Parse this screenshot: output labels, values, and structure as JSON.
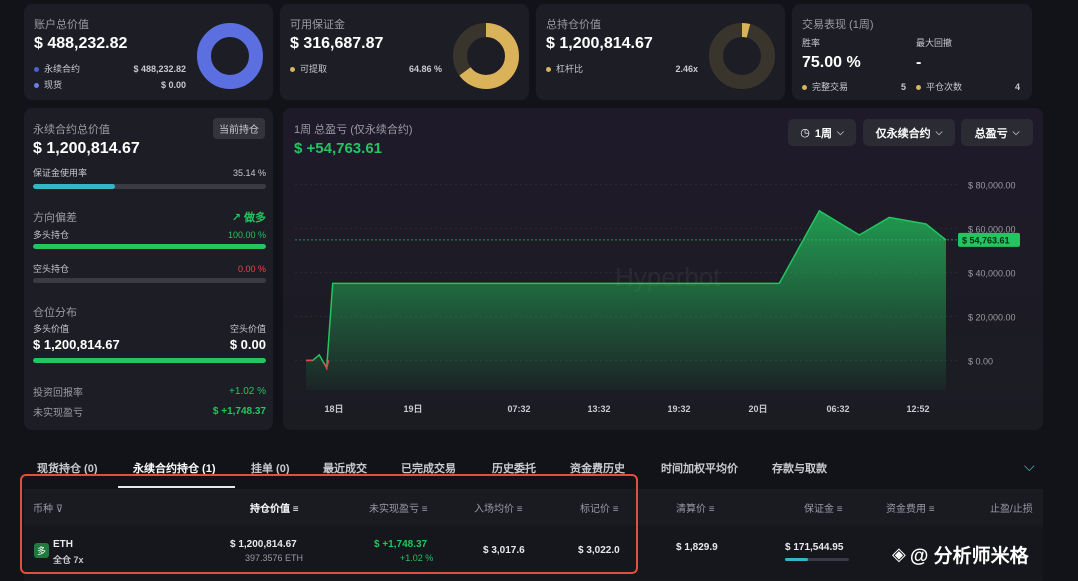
{
  "summary": {
    "account": {
      "title": "账户总价值",
      "value": "$ 488,232.82",
      "items": [
        {
          "label": "永续合约",
          "value": "$ 488,232.82",
          "color": "#4c5fd5"
        },
        {
          "label": "现货",
          "value": "$ 0.00",
          "color": "#6b7de8"
        }
      ],
      "donut_fraction": 1.0,
      "donut_color": "#5b6fe0"
    },
    "margin": {
      "title": "可用保证金",
      "value": "$ 316,687.87",
      "item_label": "可提取",
      "item_value": "64.86 %",
      "color": "#d9b25a",
      "donut_fraction": 0.6486
    },
    "position": {
      "title": "总持仓价值",
      "value": "$ 1,200,814.67",
      "item_label": "杠杆比",
      "item_value": "2.46x",
      "color": "#d9b25a",
      "donut_fraction": 0.04
    },
    "performance": {
      "title": "交易表现 (1周)",
      "win_label": "胜率",
      "win_value": "75.00 %",
      "dd_label": "最大回撤",
      "dd_value": "-",
      "completed_label": "完整交易",
      "completed_value": "5",
      "close_label": "平仓次数",
      "close_value": "4"
    }
  },
  "perp": {
    "title": "永续合约总价值",
    "badge": "当前持仓",
    "value": "$ 1,200,814.67",
    "margin_usage_label": "保证金使用率",
    "margin_usage_value": "35.14 %",
    "margin_usage": 0.3514,
    "bias_label": "方向偏差",
    "bias_value": "做多",
    "long_label": "多头持仓",
    "long_value": "100.00 %",
    "long": 1.0,
    "short_label": "空头持仓",
    "short_value": "0.00 %",
    "short": 0.0,
    "dist_label": "仓位分布",
    "long_val_label": "多头价值",
    "long_val": "$ 1,200,814.67",
    "short_val_label": "空头价值",
    "short_val": "$ 0.00",
    "roi_label": "投资回报率",
    "roi_value": "+1.02 %",
    "upnl_label": "未实现盈亏",
    "upnl_value": "$ +1,748.37"
  },
  "chart": {
    "title": "1周 总盈亏 (仅永续合约)",
    "value": "$ +54,763.61",
    "controls": {
      "period": "1周",
      "scope": "仅永续合约",
      "metric": "总盈亏"
    },
    "watermark": "Hyperbot",
    "current_label": "$ 54,763.61"
  },
  "chart_data": {
    "type": "area",
    "title": "1周 总盈亏 (仅永续合约)",
    "x_ticks": [
      "18日",
      "19日",
      "07:32",
      "13:32",
      "19:32",
      "20日",
      "06:32",
      "12:52"
    ],
    "y_ticks": [
      "$ 0.00",
      "$ 20,000.00",
      "$ 40,000.00",
      "$ 60,000.00",
      "$ 80,000.00"
    ],
    "ylim": [
      -3000,
      82000
    ],
    "x": [
      0,
      0.1,
      0.2,
      0.31,
      0.4,
      0.65,
      1.0,
      3.8,
      5.2,
      6.8,
      7.1,
      7.7,
      8.3,
      8.75,
      9.3,
      9.6
    ],
    "y": [
      0,
      0,
      2500,
      -3500,
      35000,
      35000,
      35000,
      35000,
      35000,
      35000,
      35000,
      68000,
      57000,
      65000,
      62000,
      54763.61
    ],
    "grid": true
  },
  "tabs": [
    "现货持仓 (0)",
    "永续合约持仓 (1)",
    "挂单 (0)",
    "最近成交",
    "已完成交易",
    "历史委托",
    "资金费历史",
    "时间加权平均价",
    "存款与取款"
  ],
  "active_tab": 1,
  "table": {
    "headers": [
      "币种",
      "持仓价值",
      "未实现盈亏",
      "入场均价",
      "标记价",
      "清算价",
      "保证金",
      "资金费用",
      "止盈/止损"
    ],
    "row": {
      "badge": "多",
      "coin": "ETH",
      "mode": "全仓 7x",
      "value": "$ 1,200,814.67",
      "size": "397.3576 ETH",
      "upnl": "$ +1,748.37",
      "upnl_pct": "+1.02 %",
      "entry": "$ 3,017.6",
      "mark": "$ 3,022.0",
      "liq": "$ 1,829.9",
      "margin": "$ 171,544.95"
    }
  },
  "watermark_text": "@ 分析师米格"
}
